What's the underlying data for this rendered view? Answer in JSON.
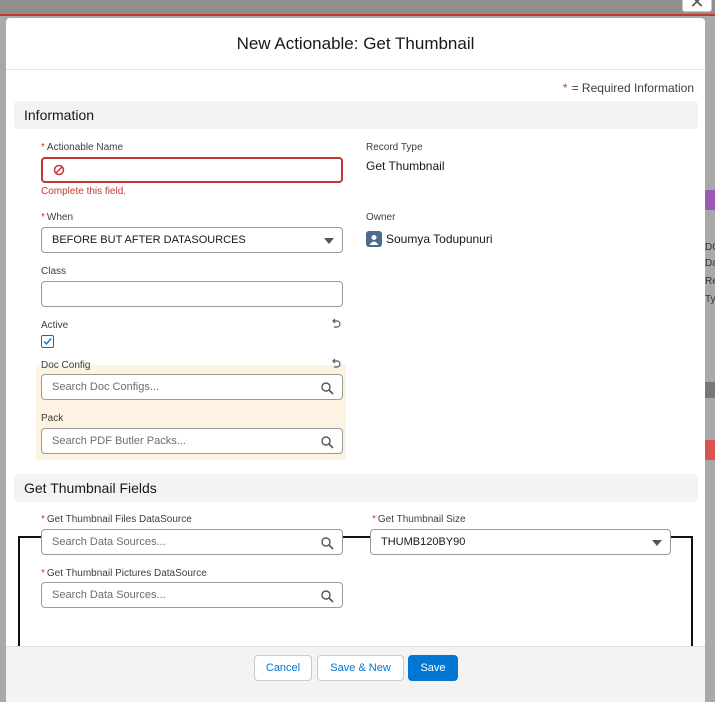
{
  "modal": {
    "title": "New Actionable: Get Thumbnail",
    "required_info_star": "*",
    "required_info_text": "= Required Information"
  },
  "section_information": {
    "title": "Information",
    "actionable_name": {
      "label": "Actionable Name",
      "value": "",
      "error": "Complete this field."
    },
    "when": {
      "label": "When",
      "value": "BEFORE BUT AFTER DATASOURCES"
    },
    "class": {
      "label": "Class",
      "value": ""
    },
    "active": {
      "label": "Active",
      "checked": true
    },
    "doc_config": {
      "label": "Doc Config",
      "placeholder": "Search Doc Configs..."
    },
    "pack": {
      "label": "Pack",
      "placeholder": "Search PDF Butler Packs..."
    },
    "record_type": {
      "label": "Record Type",
      "value": "Get Thumbnail"
    },
    "owner": {
      "label": "Owner",
      "value": "Soumya Todupunuri"
    }
  },
  "section_thumbnail": {
    "title": "Get Thumbnail Fields",
    "files_datasource": {
      "label": "Get Thumbnail Files DataSource",
      "placeholder": "Search Data Sources..."
    },
    "pictures_datasource": {
      "label": "Get Thumbnail Pictures DataSource",
      "placeholder": "Search Data Sources..."
    },
    "size": {
      "label": "Get Thumbnail Size",
      "value": "THUMB120BY90"
    }
  },
  "footer": {
    "cancel_label": "Cancel",
    "save_new_label": "Save & New",
    "save_label": "Save"
  },
  "backdrop": {
    "right_fragments": [
      "Da",
      "Re",
      "Ty"
    ],
    "top_right_fragment": "DO"
  },
  "colors": {
    "brand": "#0176d3",
    "error": "#c23934",
    "highlight": "#fcf3e2"
  },
  "icons": [
    "close-icon",
    "error-icon",
    "chevron-down-icon",
    "search-icon",
    "checkmark-icon",
    "undo-icon",
    "user-avatar-icon"
  ]
}
